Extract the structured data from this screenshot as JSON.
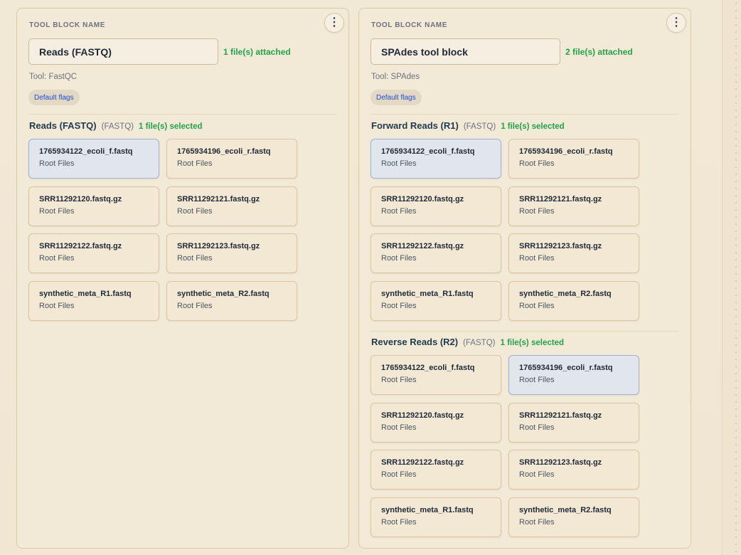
{
  "blocks": [
    {
      "label": "TOOL BLOCK NAME",
      "name_value": "Reads (FASTQ)",
      "attached": "1 file(s) attached",
      "tool": "Tool: FastQC",
      "flags": "Default flags",
      "menu_icon": "more-vertical-icon",
      "sections": [
        {
          "title": "Reads (FASTQ)",
          "type": "(FASTQ)",
          "selected_count": "1 file(s) selected",
          "files": [
            {
              "name": "1765934122_ecoli_f.fastq",
              "location": "Root Files",
              "selected": true
            },
            {
              "name": "1765934196_ecoli_r.fastq",
              "location": "Root Files",
              "selected": false
            },
            {
              "name": "SRR11292120.fastq.gz",
              "location": "Root Files",
              "selected": false
            },
            {
              "name": "SRR11292121.fastq.gz",
              "location": "Root Files",
              "selected": false
            },
            {
              "name": "SRR11292122.fastq.gz",
              "location": "Root Files",
              "selected": false
            },
            {
              "name": "SRR11292123.fastq.gz",
              "location": "Root Files",
              "selected": false
            },
            {
              "name": "synthetic_meta_R1.fastq",
              "location": "Root Files",
              "selected": false
            },
            {
              "name": "synthetic_meta_R2.fastq",
              "location": "Root Files",
              "selected": false
            }
          ]
        }
      ]
    },
    {
      "label": "TOOL BLOCK NAME",
      "name_value": "SPAdes tool block",
      "attached": "2 file(s) attached",
      "tool": "Tool: SPAdes",
      "flags": "Default flags",
      "menu_icon": "more-vertical-icon",
      "sections": [
        {
          "title": "Forward Reads (R1)",
          "type": "(FASTQ)",
          "selected_count": "1 file(s) selected",
          "files": [
            {
              "name": "1765934122_ecoli_f.fastq",
              "location": "Root Files",
              "selected": true
            },
            {
              "name": "1765934196_ecoli_r.fastq",
              "location": "Root Files",
              "selected": false
            },
            {
              "name": "SRR11292120.fastq.gz",
              "location": "Root Files",
              "selected": false
            },
            {
              "name": "SRR11292121.fastq.gz",
              "location": "Root Files",
              "selected": false
            },
            {
              "name": "SRR11292122.fastq.gz",
              "location": "Root Files",
              "selected": false
            },
            {
              "name": "SRR11292123.fastq.gz",
              "location": "Root Files",
              "selected": false
            },
            {
              "name": "synthetic_meta_R1.fastq",
              "location": "Root Files",
              "selected": false
            },
            {
              "name": "synthetic_meta_R2.fastq",
              "location": "Root Files",
              "selected": false
            }
          ]
        },
        {
          "title": "Reverse Reads (R2)",
          "type": "(FASTQ)",
          "selected_count": "1 file(s) selected",
          "files": [
            {
              "name": "1765934122_ecoli_f.fastq",
              "location": "Root Files",
              "selected": false
            },
            {
              "name": "1765934196_ecoli_r.fastq",
              "location": "Root Files",
              "selected": true
            },
            {
              "name": "SRR11292120.fastq.gz",
              "location": "Root Files",
              "selected": false
            },
            {
              "name": "SRR11292121.fastq.gz",
              "location": "Root Files",
              "selected": false
            },
            {
              "name": "SRR11292122.fastq.gz",
              "location": "Root Files",
              "selected": false
            },
            {
              "name": "SRR11292123.fastq.gz",
              "location": "Root Files",
              "selected": false
            },
            {
              "name": "synthetic_meta_R1.fastq",
              "location": "Root Files",
              "selected": false
            },
            {
              "name": "synthetic_meta_R2.fastq",
              "location": "Root Files",
              "selected": false
            }
          ]
        }
      ]
    }
  ]
}
